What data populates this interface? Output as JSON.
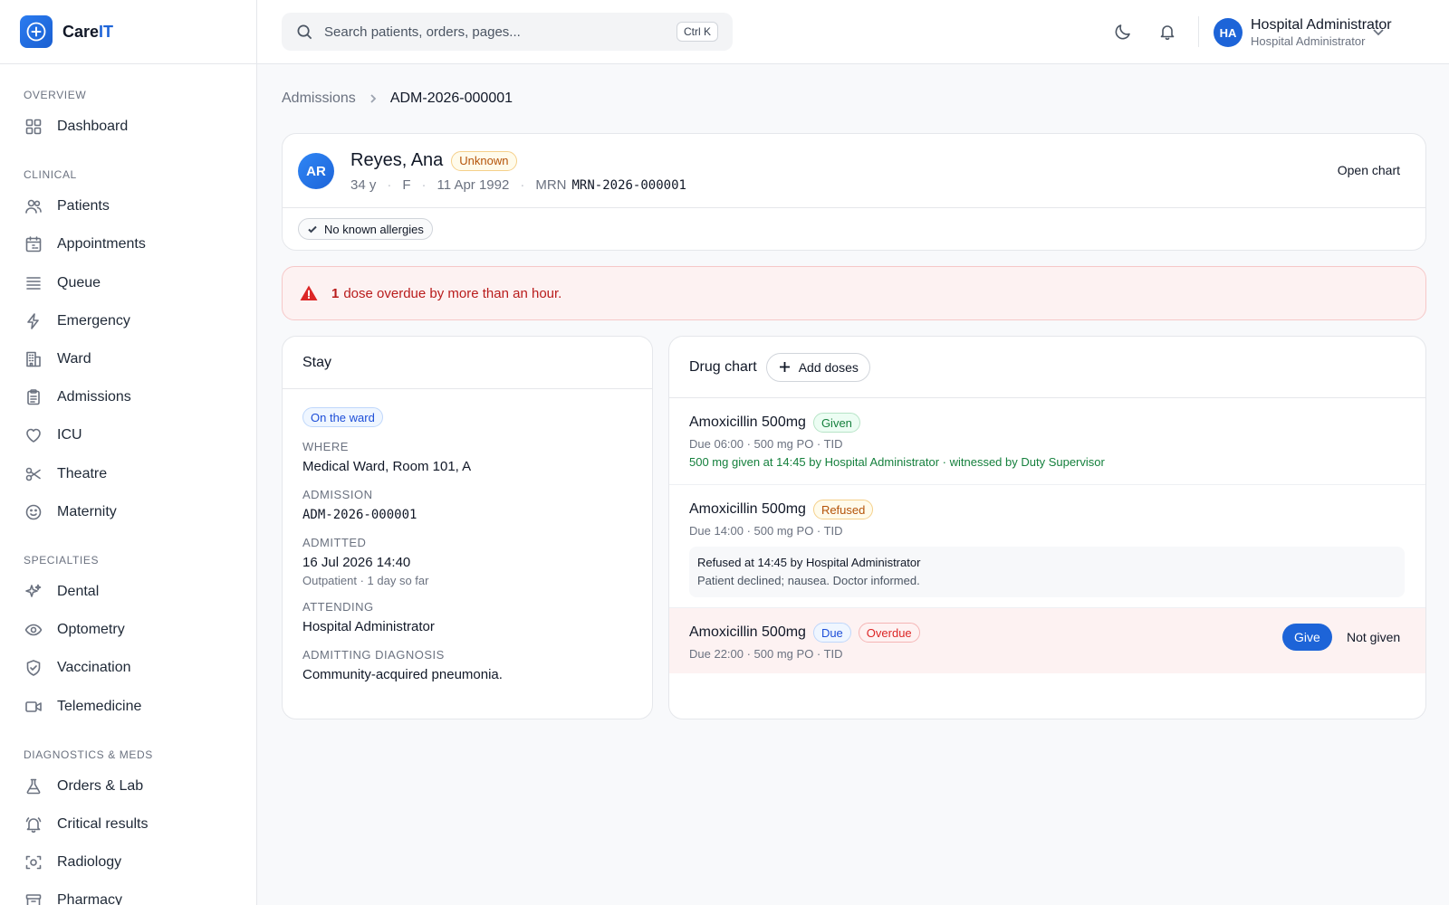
{
  "app": {
    "name_prefix": "Care",
    "name_suffix": "IT"
  },
  "search": {
    "placeholder": "Search patients, orders, pages...",
    "shortcut": "Ctrl K"
  },
  "user": {
    "initials": "HA",
    "name": "Hospital Administrator",
    "role": "Hospital Administrator"
  },
  "sidebar": {
    "sections": [
      {
        "title": "OVERVIEW",
        "items": [
          {
            "label": "Dashboard",
            "icon": "grid-icon"
          }
        ]
      },
      {
        "title": "CLINICAL",
        "items": [
          {
            "label": "Patients",
            "icon": "users-icon"
          },
          {
            "label": "Appointments",
            "icon": "calendar-icon"
          },
          {
            "label": "Queue",
            "icon": "list-icon"
          },
          {
            "label": "Emergency",
            "icon": "bolt-icon"
          },
          {
            "label": "Ward",
            "icon": "building-icon"
          },
          {
            "label": "Admissions",
            "icon": "clipboard-icon"
          },
          {
            "label": "ICU",
            "icon": "heart-icon"
          },
          {
            "label": "Theatre",
            "icon": "scissors-icon"
          },
          {
            "label": "Maternity",
            "icon": "smile-icon"
          }
        ]
      },
      {
        "title": "SPECIALTIES",
        "items": [
          {
            "label": "Dental",
            "icon": "sparkles-icon"
          },
          {
            "label": "Optometry",
            "icon": "eye-icon"
          },
          {
            "label": "Vaccination",
            "icon": "shield-check-icon"
          },
          {
            "label": "Telemedicine",
            "icon": "video-icon"
          }
        ]
      },
      {
        "title": "DIAGNOSTICS & MEDS",
        "items": [
          {
            "label": "Orders & Lab",
            "icon": "flask-icon"
          },
          {
            "label": "Critical results",
            "icon": "bell-alert-icon"
          },
          {
            "label": "Radiology",
            "icon": "scan-icon"
          },
          {
            "label": "Pharmacy",
            "icon": "box-icon"
          }
        ]
      }
    ]
  },
  "breadcrumb": {
    "parent": "Admissions",
    "current": "ADM-2026-000001"
  },
  "patient": {
    "initials": "AR",
    "name": "Reyes, Ana",
    "tag": "Unknown",
    "age": "34 y",
    "sex": "F",
    "dob": "11 Apr 1992",
    "mrn_label": "MRN",
    "mrn": "MRN-2026-000001",
    "open_chart": "Open chart",
    "allergies": "No known allergies"
  },
  "alert": {
    "count": "1",
    "text": "dose overdue by more than an hour."
  },
  "stay": {
    "title": "Stay",
    "status": "On the ward",
    "where_label": "WHERE",
    "where": "Medical Ward, Room 101, A",
    "admission_label": "ADMISSION",
    "admission": "ADM-2026-000001",
    "admitted_label": "ADMITTED",
    "admitted": "16 Jul 2026 14:40",
    "admitted_sub": "Outpatient · 1 day so far",
    "attending_label": "ATTENDING",
    "attending": "Hospital Administrator",
    "diagnosis_label": "ADMITTING DIAGNOSIS",
    "diagnosis": "Community-acquired pneumonia."
  },
  "drug_chart": {
    "title": "Drug chart",
    "add_label": "Add doses",
    "doses": [
      {
        "drug": "Amoxicillin 500mg",
        "status": "Given",
        "due": "Due 06:00 · 500 mg PO · TID",
        "note": "500 mg given at 14:45 by Hospital Administrator · witnessed by Duty Supervisor"
      },
      {
        "drug": "Amoxicillin 500mg",
        "status": "Refused",
        "due": "Due 14:00 · 500 mg PO · TID",
        "refusal_title": "Refused at 14:45 by Hospital Administrator",
        "refusal_note": "Patient declined; nausea. Doctor informed."
      },
      {
        "drug": "Amoxicillin 500mg",
        "status": "Due",
        "flag": "Overdue",
        "due": "Due 22:00 · 500 mg PO · TID",
        "give_label": "Give",
        "not_given_label": "Not given"
      }
    ]
  },
  "colors": {
    "accent": "#1d64d8",
    "danger": "#dc2626",
    "success": "#15803d",
    "warning": "#b45309"
  }
}
